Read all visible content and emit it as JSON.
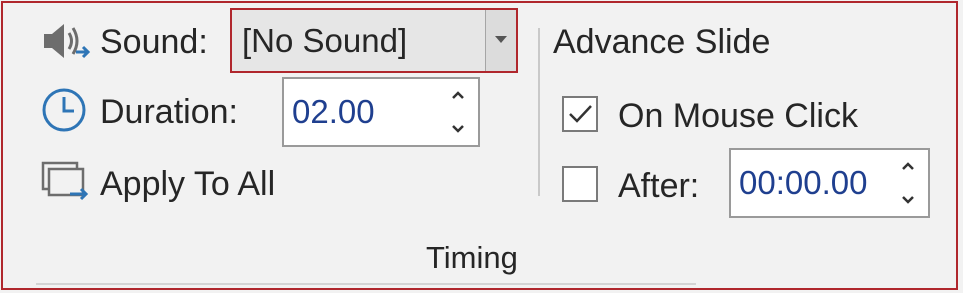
{
  "timing_group": {
    "sound": {
      "label": "Sound:",
      "value": "[No Sound]",
      "icon": "speaker-icon"
    },
    "duration": {
      "label": "Duration:",
      "value": "02.00",
      "icon": "clock-icon"
    },
    "apply_to_all": {
      "label": "Apply To All",
      "icon": "apply-to-all-icon"
    },
    "advance_slide": {
      "heading": "Advance Slide",
      "on_mouse_click": {
        "label": "On Mouse Click",
        "checked": true
      },
      "after": {
        "label": "After:",
        "value": "00:00.00",
        "checked": false
      }
    },
    "group_label": "Timing"
  },
  "colors": {
    "highlight_border": "#b0272d",
    "value_text": "#1f3f8f",
    "icon_blue": "#2e75b6",
    "icon_gray": "#6d6d6d"
  }
}
